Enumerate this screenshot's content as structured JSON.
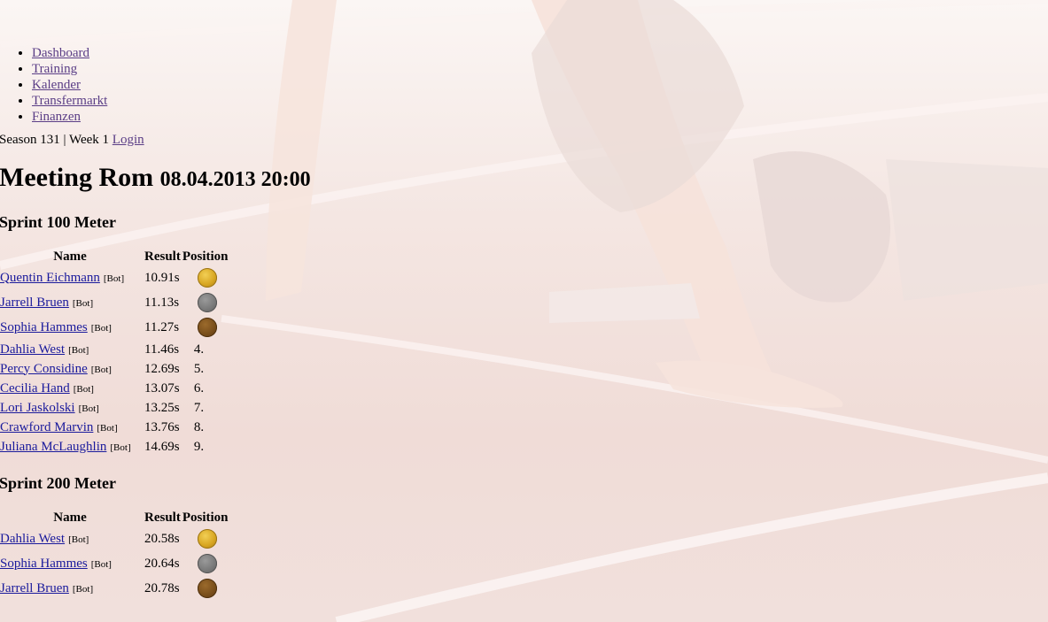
{
  "nav": {
    "items": [
      {
        "label": "Dashboard"
      },
      {
        "label": "Training"
      },
      {
        "label": "Kalender"
      },
      {
        "label": "Transfermarkt"
      },
      {
        "label": "Finanzen"
      }
    ]
  },
  "status": {
    "season": "Season 131",
    "separator": "|",
    "week": "Week 1",
    "login": "Login"
  },
  "meeting": {
    "title": "Meeting Rom",
    "datetime": "08.04.2013 20:00"
  },
  "headers": {
    "name": "Name",
    "result": "Result",
    "position": "Position"
  },
  "bot_tag": "[Bot]",
  "medal_colors": {
    "gold": "#d8a622",
    "silver": "#7a7a7a",
    "bronze": "#7a4f1b"
  },
  "events": [
    {
      "title": "Sprint 100 Meter",
      "rows": [
        {
          "name": "Quentin Eichmann",
          "result": "10.91s",
          "medal": "gold"
        },
        {
          "name": "Jarrell Bruen",
          "result": "11.13s",
          "medal": "silver"
        },
        {
          "name": "Sophia Hammes",
          "result": "11.27s",
          "medal": "bronze"
        },
        {
          "name": "Dahlia West",
          "result": "11.46s",
          "position": "4."
        },
        {
          "name": "Percy Considine",
          "result": "12.69s",
          "position": "5."
        },
        {
          "name": "Cecilia Hand",
          "result": "13.07s",
          "position": "6."
        },
        {
          "name": "Lori Jaskolski",
          "result": "13.25s",
          "position": "7."
        },
        {
          "name": "Crawford Marvin",
          "result": "13.76s",
          "position": "8."
        },
        {
          "name": "Juliana McLaughlin",
          "result": "14.69s",
          "position": "9."
        }
      ]
    },
    {
      "title": "Sprint 200 Meter",
      "rows": [
        {
          "name": "Dahlia West",
          "result": "20.58s",
          "medal": "gold"
        },
        {
          "name": "Sophia Hammes",
          "result": "20.64s",
          "medal": "silver"
        },
        {
          "name": "Jarrell Bruen",
          "result": "20.78s",
          "medal": "bronze"
        }
      ]
    }
  ]
}
